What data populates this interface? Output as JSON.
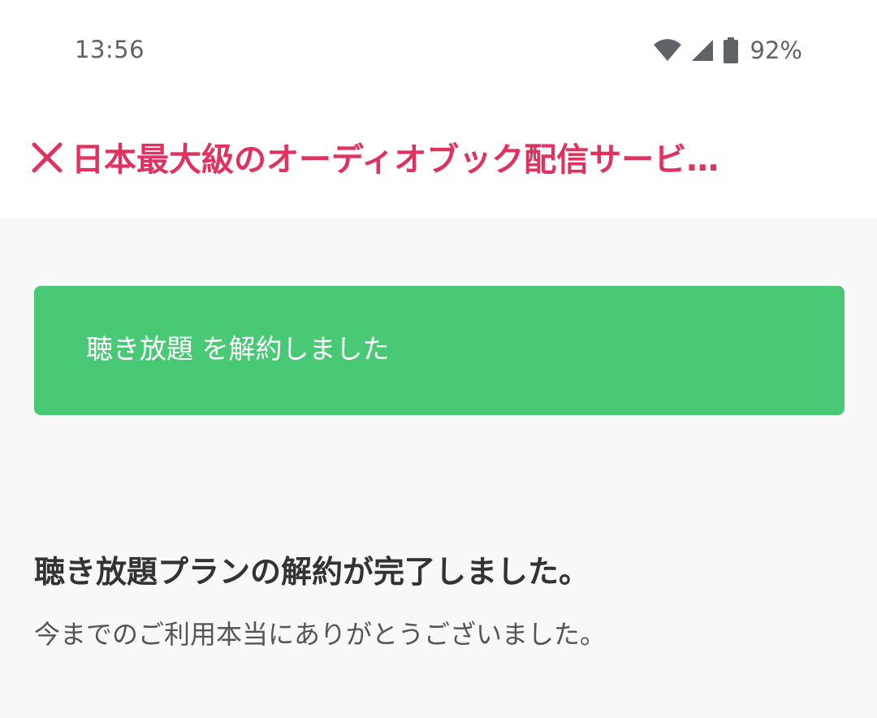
{
  "status_bar": {
    "time": "13:56",
    "battery": "92%",
    "icons": [
      "wifi-icon",
      "signal-icon",
      "battery-icon"
    ]
  },
  "header": {
    "close_icon": "close-icon",
    "title": "日本最大級のオーディオブック配信サービ…",
    "title_color": "#e0325e"
  },
  "banner": {
    "text": "聴き放題 を解約しました",
    "color": "#49c975"
  },
  "content": {
    "heading": "聴き放題プランの解約が完了しました。",
    "message": "今までのご利用本当にありがとうございました。"
  }
}
